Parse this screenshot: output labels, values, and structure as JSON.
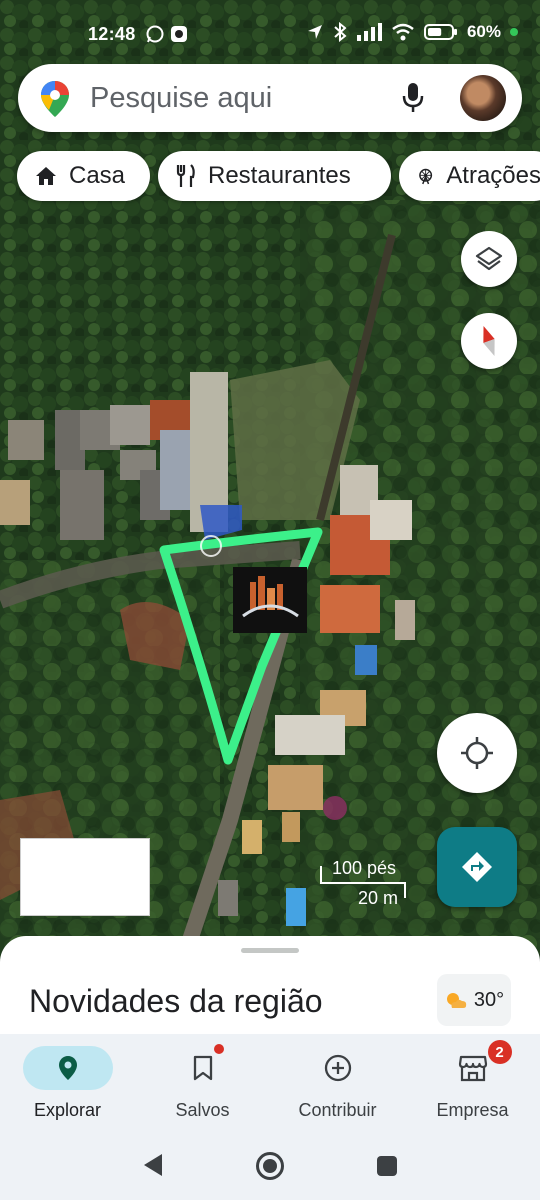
{
  "status_bar": {
    "time": "12:48",
    "battery_percent": "60%",
    "battery_level": 0.6
  },
  "search": {
    "placeholder": "Pesquise aqui",
    "icons": [
      "google-maps-pin-icon",
      "microphone-icon",
      "profile-avatar"
    ]
  },
  "chips": [
    {
      "label": "Casa",
      "icon": "home-icon"
    },
    {
      "label": "Restaurantes",
      "icon": "fork-knife-icon"
    },
    {
      "label": "Atrações",
      "icon": "ferris-wheel-icon"
    }
  ],
  "map": {
    "scale_imperial": "100 pés",
    "scale_metric": "20 m",
    "boundary_color": "#3cf08a"
  },
  "sheet": {
    "title": "Novidades da região",
    "weather_temp": "30°",
    "weather_icon": "partly-cloudy-icon"
  },
  "bottom_nav": {
    "items": [
      {
        "label": "Explorar",
        "icon": "location-pin-icon",
        "active": true
      },
      {
        "label": "Salvos",
        "icon": "bookmark-icon"
      },
      {
        "label": "Contribuir",
        "icon": "add-circle-icon"
      },
      {
        "label": "Empresa",
        "icon": "storefront-icon",
        "badge": "2"
      }
    ]
  },
  "colors": {
    "accent_teal": "#0e7c86",
    "active_nav_bg": "#bfe7f2",
    "badge_red": "#d93025"
  }
}
